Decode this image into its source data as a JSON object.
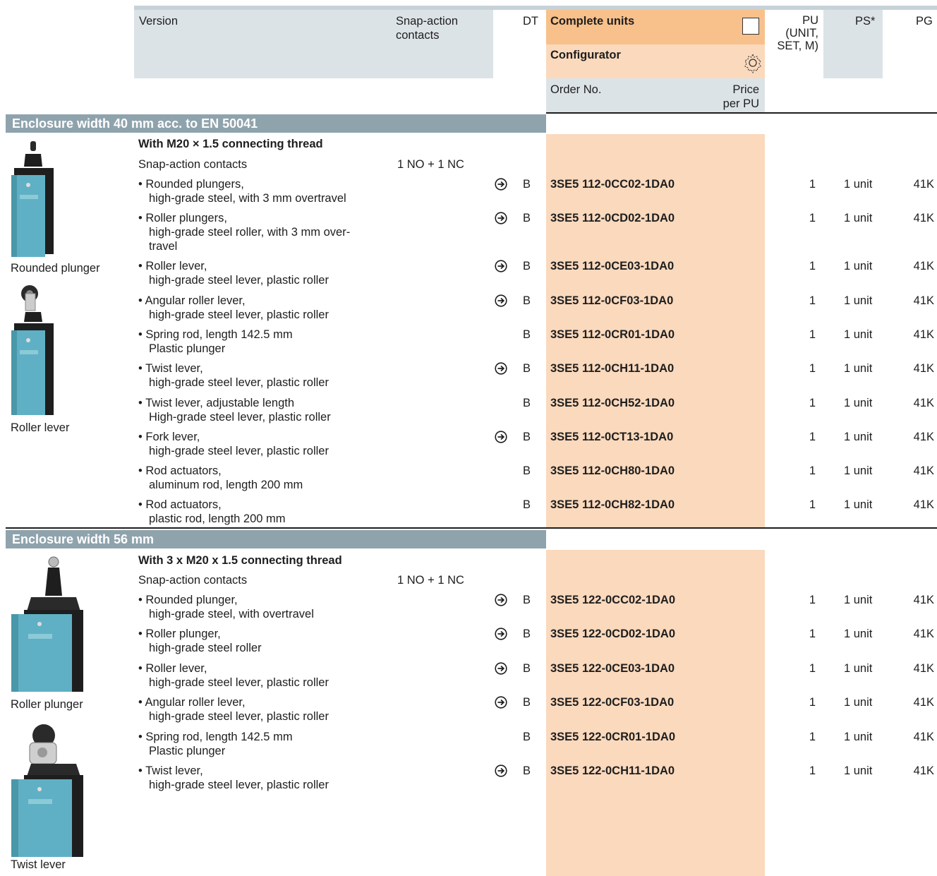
{
  "header": {
    "version": "Version",
    "snap_action": "Snap-action contacts",
    "dt": "DT",
    "complete_units": "Complete units",
    "configurator": "Configurator",
    "order_no": "Order No.",
    "price": "Price per PU",
    "pu": "PU (UNIT, SET, M)",
    "ps": "PS*",
    "pg": "PG"
  },
  "section1": {
    "title": "Enclosure width 40 mm acc. to EN 50041",
    "subhead": "With M20 × 1.5 connecting thread",
    "contacts_label": "Snap-action contacts",
    "contacts_value": "1 NO + 1 NC",
    "captions": [
      "Rounded plunger",
      "Roller lever"
    ],
    "rows": [
      {
        "l1": "• Rounded plungers,",
        "l2": "high-grade steel, with 3 mm overtravel",
        "l3": "",
        "arrow": true,
        "dt": "B",
        "order": "3SE5 112-0CC02-1DA0",
        "pu": "1",
        "ps": "1 unit",
        "pg": "41K"
      },
      {
        "l1": "• Roller plungers,",
        "l2": "high-grade steel roller, with 3 mm over-",
        "l3": "travel",
        "arrow": true,
        "dt": "B",
        "order": "3SE5 112-0CD02-1DA0",
        "pu": "1",
        "ps": "1 unit",
        "pg": "41K"
      },
      {
        "l1": "• Roller lever,",
        "l2": "high-grade steel lever, plastic roller",
        "l3": "",
        "arrow": true,
        "dt": "B",
        "order": "3SE5 112-0CE03-1DA0",
        "pu": "1",
        "ps": "1 unit",
        "pg": "41K"
      },
      {
        "l1": "• Angular roller lever,",
        "l2": "high-grade steel lever, plastic roller",
        "l3": "",
        "arrow": true,
        "dt": "B",
        "order": "3SE5 112-0CF03-1DA0",
        "pu": "1",
        "ps": "1 unit",
        "pg": "41K"
      },
      {
        "l1": "• Spring rod, length 142.5 mm",
        "l2": "Plastic plunger",
        "l3": "",
        "arrow": false,
        "dt": "B",
        "order": "3SE5 112-0CR01-1DA0",
        "pu": "1",
        "ps": "1 unit",
        "pg": "41K"
      },
      {
        "l1": "• Twist lever,",
        "l2": "high-grade steel lever, plastic roller",
        "l3": "",
        "arrow": true,
        "dt": "B",
        "order": "3SE5 112-0CH11-1DA0",
        "pu": "1",
        "ps": "1 unit",
        "pg": "41K"
      },
      {
        "l1": "• Twist lever, adjustable length",
        "l2": "High-grade steel lever, plastic roller",
        "l3": "",
        "arrow": false,
        "dt": "B",
        "order": "3SE5 112-0CH52-1DA0",
        "pu": "1",
        "ps": "1 unit",
        "pg": "41K"
      },
      {
        "l1": "• Fork lever,",
        "l2": "high-grade steel lever, plastic roller",
        "l3": "",
        "arrow": true,
        "dt": "B",
        "order": "3SE5 112-0CT13-1DA0",
        "pu": "1",
        "ps": "1 unit",
        "pg": "41K"
      },
      {
        "l1": "• Rod actuators,",
        "l2": "aluminum rod, length 200 mm",
        "l3": "",
        "arrow": false,
        "dt": "B",
        "order": "3SE5 112-0CH80-1DA0",
        "pu": "1",
        "ps": "1 unit",
        "pg": "41K"
      },
      {
        "l1": "• Rod actuators,",
        "l2": "plastic rod, length 200 mm",
        "l3": "",
        "arrow": false,
        "dt": "B",
        "order": "3SE5 112-0CH82-1DA0",
        "pu": "1",
        "ps": "1 unit",
        "pg": "41K"
      }
    ]
  },
  "section2": {
    "title": "Enclosure width 56 mm",
    "subhead": "With 3 x M20 x 1.5 connecting thread",
    "contacts_label": "Snap-action contacts",
    "contacts_value": "1 NO + 1 NC",
    "captions": [
      "Roller plunger",
      "Twist lever"
    ],
    "rows": [
      {
        "l1": "• Rounded plunger,",
        "l2": "high-grade steel, with overtravel",
        "arrow": true,
        "dt": "B",
        "order": "3SE5 122-0CC02-1DA0",
        "pu": "1",
        "ps": "1 unit",
        "pg": "41K"
      },
      {
        "l1": "• Roller plunger,",
        "l2": "high-grade steel roller",
        "arrow": true,
        "dt": "B",
        "order": "3SE5 122-0CD02-1DA0",
        "pu": "1",
        "ps": "1 unit",
        "pg": "41K"
      },
      {
        "l1": "• Roller lever,",
        "l2": "high-grade steel lever, plastic roller",
        "arrow": true,
        "dt": "B",
        "order": "3SE5 122-0CE03-1DA0",
        "pu": "1",
        "ps": "1 unit",
        "pg": "41K"
      },
      {
        "l1": "• Angular roller lever,",
        "l2": "high-grade steel lever, plastic roller",
        "arrow": true,
        "dt": "B",
        "order": "3SE5 122-0CF03-1DA0",
        "pu": "1",
        "ps": "1 unit",
        "pg": "41K"
      },
      {
        "l1": "• Spring rod, length 142.5 mm",
        "l2": "Plastic plunger",
        "arrow": false,
        "dt": "B",
        "order": "3SE5 122-0CR01-1DA0",
        "pu": "1",
        "ps": "1 unit",
        "pg": "41K"
      },
      {
        "l1": "• Twist lever,",
        "l2": "high-grade steel lever, plastic roller",
        "arrow": true,
        "dt": "B",
        "order": "3SE5 122-0CH11-1DA0",
        "pu": "1",
        "ps": "1 unit",
        "pg": "41K"
      }
    ]
  },
  "colors": {
    "accent_dark": "#f8c08a",
    "accent_light": "#fad9bd",
    "header_gray": "#dce3e7",
    "section_bar": "#8fa3ad",
    "switch_body": "#5fb0c4"
  }
}
